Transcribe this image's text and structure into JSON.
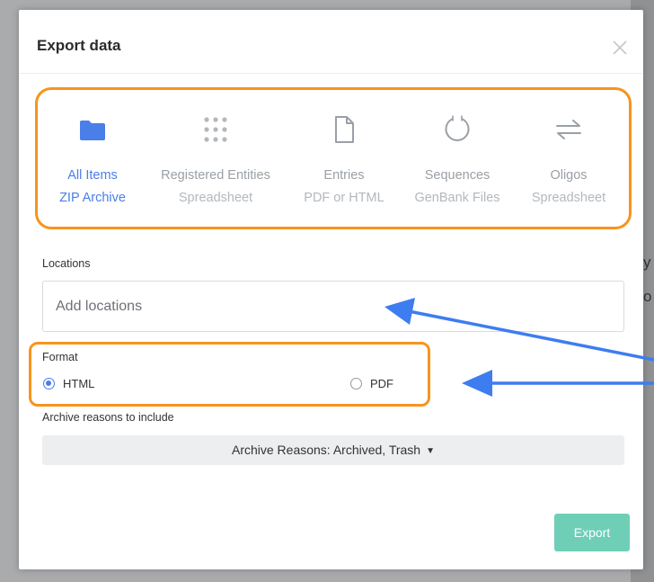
{
  "background": {
    "partial_texts": [
      "y",
      "o"
    ]
  },
  "modal": {
    "title": "Export data",
    "close_icon": "close-icon"
  },
  "export_types": [
    {
      "icon": "folder-icon",
      "name": "All Items",
      "format": "ZIP Archive",
      "selected": true
    },
    {
      "icon": "dot-grid-icon",
      "name": "Registered Entities",
      "format": "Spreadsheet",
      "selected": false
    },
    {
      "icon": "document-icon",
      "name": "Entries",
      "format": "PDF or HTML",
      "selected": false
    },
    {
      "icon": "circular-sequence-icon",
      "name": "Sequences",
      "format": "GenBank Files",
      "selected": false
    },
    {
      "icon": "swap-arrows-icon",
      "name": "Oligos",
      "format": "Spreadsheet",
      "selected": false
    }
  ],
  "locations": {
    "label": "Locations",
    "placeholder": "Add locations",
    "value": ""
  },
  "format": {
    "label": "Format",
    "options": [
      {
        "label": "HTML",
        "checked": true
      },
      {
        "label": "PDF",
        "checked": false
      }
    ]
  },
  "archive": {
    "label": "Archive reasons to include",
    "dropdown_value": "Archive Reasons: Archived, Trash"
  },
  "export_button": {
    "label": "Export"
  },
  "colors": {
    "accent_blue": "#4a7ee8",
    "highlight_orange": "#f7941d",
    "annotation_arrow": "#3d7df0",
    "export_green": "#6ecfb6"
  }
}
